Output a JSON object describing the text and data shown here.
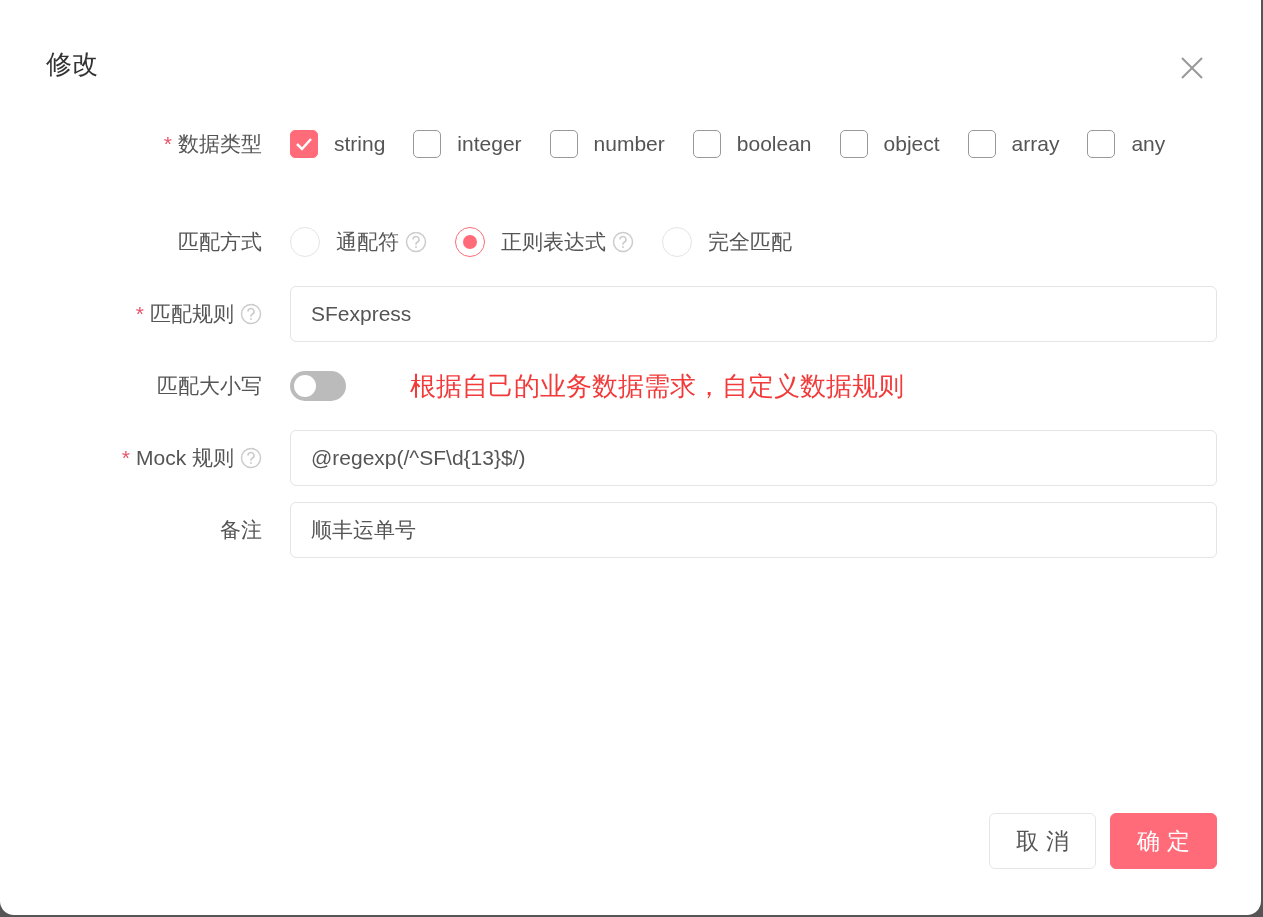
{
  "dialog": {
    "title": "修改"
  },
  "fields": [
    {
      "kind": "checkboxes",
      "label": "数据类型",
      "asterisk": "*",
      "options": [
        {
          "label": "string",
          "checked": true
        },
        {
          "label": "integer",
          "checked": false
        },
        {
          "label": "number",
          "checked": false
        },
        {
          "label": "boolean",
          "checked": false
        },
        {
          "label": "object",
          "checked": false
        },
        {
          "label": "array",
          "checked": false
        },
        {
          "label": "any",
          "checked": false
        }
      ]
    },
    {
      "kind": "radios",
      "label": "匹配方式",
      "options": [
        {
          "label": "通配符",
          "selected": false,
          "help": true
        },
        {
          "label": "正则表达式",
          "selected": true,
          "help": true
        },
        {
          "label": "完全匹配",
          "selected": false
        }
      ]
    },
    {
      "kind": "input",
      "label": "匹配规则",
      "asterisk": "*",
      "help": true,
      "value": "SFexpress"
    },
    {
      "kind": "switch",
      "label": "匹配大小写",
      "on": false,
      "annotation": "根据自己的业务数据需求，自定义数据规则"
    },
    {
      "kind": "input",
      "label": "Mock 规则",
      "asterisk": "*",
      "help": true,
      "value": "@regexp(/^SF\\d{13}$/)"
    },
    {
      "kind": "input",
      "label": "备注",
      "value": "顺丰运单号"
    }
  ],
  "buttons": [
    {
      "label": "取 消",
      "kind": "default"
    },
    {
      "label": "确 定",
      "kind": "primary"
    }
  ]
}
